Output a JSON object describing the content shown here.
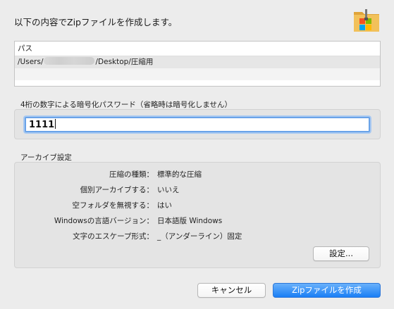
{
  "dialog": {
    "title": "以下の内容でZipファイルを作成します。",
    "app_icon": "zip-archiver-folder-icon"
  },
  "path_table": {
    "header": "パス",
    "rows": [
      {
        "prefix": "/Users/",
        "suffix": "/Desktop/圧縮用"
      }
    ]
  },
  "password": {
    "label": "4桁の数字による暗号化パスワード（省略時は暗号化しません）",
    "value": "1111"
  },
  "archive_settings": {
    "label": "アーカイブ設定",
    "rows": [
      {
        "key": "圧縮の種類：",
        "value": "標準的な圧縮"
      },
      {
        "key": "個別アーカイブする：",
        "value": "いいえ"
      },
      {
        "key": "空フォルダを無視する：",
        "value": "はい"
      },
      {
        "key": "Windowsの言語バージョン：",
        "value": "日本語版 Windows"
      },
      {
        "key": "文字のエスケープ形式：",
        "value": "_（アンダーライン）固定"
      }
    ],
    "settings_button": "設定..."
  },
  "buttons": {
    "cancel": "キャンセル",
    "create": "Zipファイルを作成"
  },
  "colors": {
    "primary_button": "#1a7ef5",
    "focus_ring": "#6aa3e8"
  }
}
